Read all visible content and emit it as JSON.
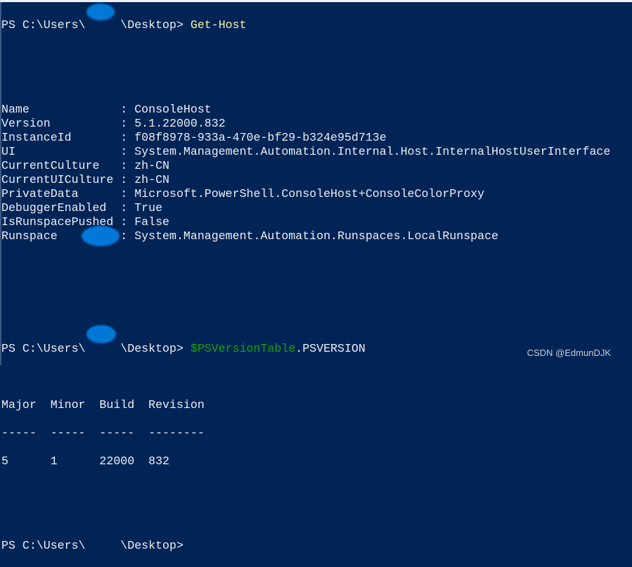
{
  "colors": {
    "background": "#012456",
    "text": "#eeedf0",
    "command": "#f9f1a5",
    "variable": "#13a10e",
    "redaction": "#0078d7"
  },
  "prompt1": {
    "prefix": "PS C:\\Users\\",
    "suffix": "\\Desktop> ",
    "command": "Get-Host"
  },
  "host_props": [
    {
      "key": "Name            ",
      "value": "ConsoleHost"
    },
    {
      "key": "Version         ",
      "value": "5.1.22000.832"
    },
    {
      "key": "InstanceId      ",
      "value": "f08f8978-933a-470e-bf29-b324e95d713e"
    },
    {
      "key": "UI              ",
      "value": "System.Management.Automation.Internal.Host.InternalHostUserInterface"
    },
    {
      "key": "CurrentCulture  ",
      "value": "zh-CN"
    },
    {
      "key": "CurrentUICulture",
      "value": "zh-CN"
    },
    {
      "key": "PrivateData     ",
      "value": "Microsoft.PowerShell.ConsoleHost+ConsoleColorProxy"
    },
    {
      "key": "DebuggerEnabled ",
      "value": "True"
    },
    {
      "key": "IsRunspacePushed",
      "value": "False"
    },
    {
      "key": "Runspace        ",
      "value": "System.Management.Automation.Runspaces.LocalRunspace"
    }
  ],
  "separator": " : ",
  "prompt2": {
    "prefix": "PS C:\\Users\\",
    "suffix": "\\Desktop> ",
    "variable": "$PSVersionTable",
    "member": ".PSVERSION"
  },
  "version_table": {
    "header": "Major  Minor  Build  Revision",
    "dashes": "-----  -----  -----  --------",
    "row": "5      1      22000  832"
  },
  "prompt3": {
    "prefix": "PS C:\\Users\\",
    "suffix": "\\Desktop>"
  },
  "watermark": "CSDN @EdmunDJK"
}
